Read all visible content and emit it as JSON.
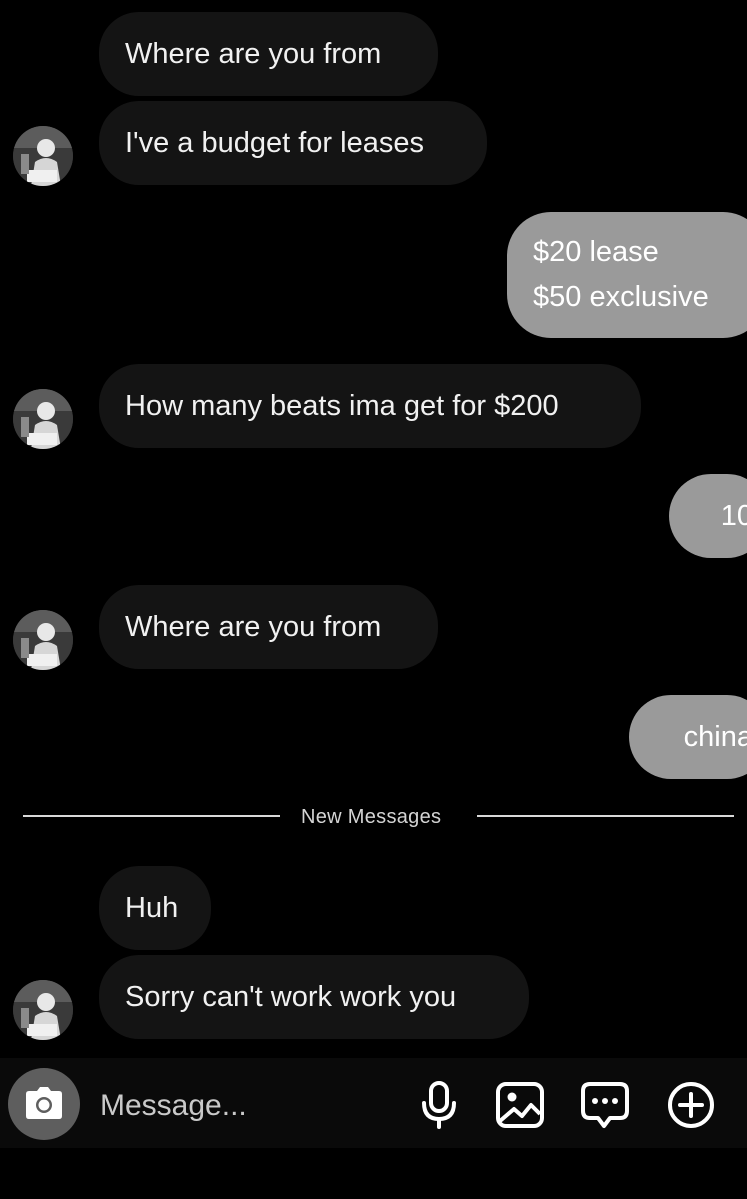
{
  "thread": {
    "messages": [
      {
        "id": "m1",
        "direction": "incoming",
        "text": "Where are you from"
      },
      {
        "id": "m2",
        "direction": "incoming",
        "text": "I've a budget for leases"
      },
      {
        "id": "m3",
        "direction": "outgoing",
        "lines": [
          "$20 lease",
          "$50 exclusive"
        ]
      },
      {
        "id": "m4",
        "direction": "incoming",
        "text": "How many beats ima get for $200"
      },
      {
        "id": "m5",
        "direction": "outgoing",
        "text": "10"
      },
      {
        "id": "m6",
        "direction": "incoming",
        "text": "Where are you from"
      },
      {
        "id": "m7",
        "direction": "outgoing",
        "text": "china"
      },
      {
        "id": "m8",
        "direction": "incoming",
        "text": "Huh"
      },
      {
        "id": "m9",
        "direction": "incoming",
        "text": "Sorry can't work work you"
      }
    ],
    "new_messages_divider": "New Messages"
  },
  "composer": {
    "placeholder": "Message...",
    "camera_icon": "camera-icon",
    "mic_icon": "microphone-icon",
    "gallery_icon": "image-icon",
    "sticker_icon": "chat-bubble-icon",
    "plus_icon": "plus-circle-icon"
  },
  "colors": {
    "background": "#000000",
    "incoming_bubble": "#141414",
    "outgoing_bubble": "#9a9a9a",
    "camera_button": "#5e5e5e"
  }
}
